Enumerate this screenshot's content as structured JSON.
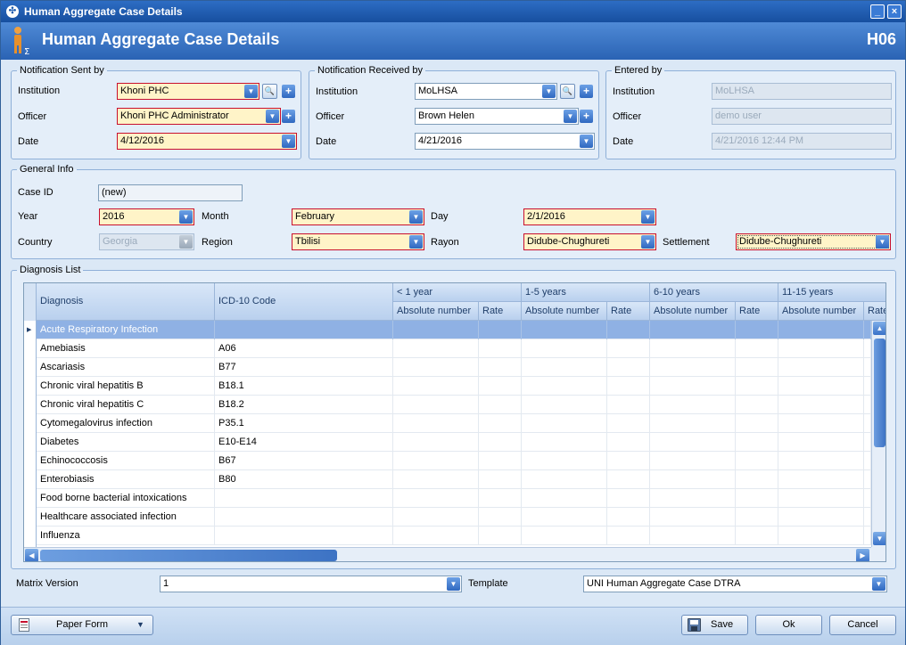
{
  "window": {
    "title": "Human Aggregate Case Details"
  },
  "header": {
    "title": "Human Aggregate Case Details",
    "code": "H06"
  },
  "notification_sent": {
    "legend": "Notification Sent by",
    "institution_label": "Institution",
    "institution": "Khoni PHC",
    "officer_label": "Officer",
    "officer": "Khoni PHC Administrator",
    "date_label": "Date",
    "date": "4/12/2016"
  },
  "notification_received": {
    "legend": "Notification Received by",
    "institution_label": "Institution",
    "institution": "MoLHSA",
    "officer_label": "Officer",
    "officer": "Brown Helen",
    "date_label": "Date",
    "date": "4/21/2016"
  },
  "entered": {
    "legend": "Entered by",
    "institution_label": "Institution",
    "institution": "MoLHSA",
    "officer_label": "Officer",
    "officer": "demo user",
    "date_label": "Date",
    "date": "4/21/2016 12:44 PM"
  },
  "general": {
    "legend": "General Info",
    "case_id_label": "Case ID",
    "case_id": "(new)",
    "year_label": "Year",
    "year": "2016",
    "month_label": "Month",
    "month": "February",
    "day_label": "Day",
    "day": "2/1/2016",
    "country_label": "Country",
    "country": "Georgia",
    "region_label": "Region",
    "region": "Tbilisi",
    "rayon_label": "Rayon",
    "rayon": "Didube-Chughureti",
    "settlement_label": "Settlement",
    "settlement": "Didube-Chughureti"
  },
  "diagnosis": {
    "legend": "Diagnosis List",
    "columns": {
      "diagnosis": "Diagnosis",
      "icd": "ICD-10 Code",
      "g1": "< 1 year",
      "g2": "1-5 years",
      "g3": "6-10 years",
      "g4": "11-15 years",
      "abs": "Absolute number",
      "rate": "Rate",
      "rate_partial": "Rate"
    },
    "rows": [
      {
        "diagnosis": "Acute Respiratory Infection",
        "icd": ""
      },
      {
        "diagnosis": "Amebiasis",
        "icd": "A06"
      },
      {
        "diagnosis": "Ascariasis",
        "icd": "B77"
      },
      {
        "diagnosis": "Chronic viral hepatitis B",
        "icd": "B18.1"
      },
      {
        "diagnosis": "Chronic viral hepatitis C",
        "icd": "B18.2"
      },
      {
        "diagnosis": "Cytomegalovirus infection",
        "icd": "P35.1"
      },
      {
        "diagnosis": "Diabetes",
        "icd": "E10-E14"
      },
      {
        "diagnosis": "Echinococcosis",
        "icd": "B67"
      },
      {
        "diagnosis": "Enterobiasis",
        "icd": "B80"
      },
      {
        "diagnosis": "Food borne bacterial intoxications",
        "icd": ""
      },
      {
        "diagnosis": "Healthcare associated infection",
        "icd": ""
      },
      {
        "diagnosis": "Influenza",
        "icd": ""
      }
    ]
  },
  "matrix": {
    "label": "Matrix Version",
    "value": "1"
  },
  "template": {
    "label": "Template",
    "value": "UNI Human Aggregate Case DTRA"
  },
  "footer": {
    "paper_form": "Paper Form",
    "save": "Save",
    "ok": "Ok",
    "cancel": "Cancel"
  },
  "icons": {
    "title": "app-logo-icon",
    "header": "human-aggregate-icon",
    "minimize": "minimize-icon",
    "close": "close-icon",
    "dropdown": "chevron-down-icon",
    "search": "search-icon",
    "add": "plus-icon",
    "save": "floppy-disk-icon",
    "paper": "document-icon"
  }
}
